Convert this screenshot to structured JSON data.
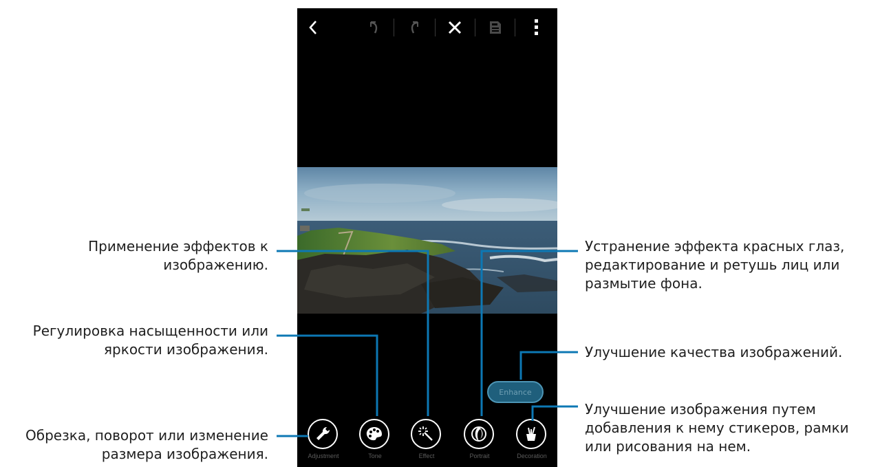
{
  "phone": {
    "enhance_button": "Enhance",
    "toolbar": [
      "Adjustment",
      "Tone",
      "Effect",
      "Portrait",
      "Decoration"
    ]
  },
  "callouts": {
    "effect": "Применение эффектов к изображению.",
    "tone": "Регулировка насыщенности или яркости изображения.",
    "adjustment": "Обрезка, поворот или изменение размера изображения.",
    "portrait": "Устранение эффекта красных глаз, редактирование и ретушь лиц или размытие фона.",
    "enhance": "Улучшение качества изображений.",
    "decoration": "Улучшение изображения путем добавления к нему стикеров, рамки или рисования на нем."
  },
  "colors": {
    "leader_line": "#0d78b4",
    "accent": "#1f5f7c"
  },
  "icons": [
    "back-icon",
    "undo-icon",
    "redo-icon",
    "close-icon",
    "save-icon",
    "more-icon",
    "wrench-icon",
    "palette-icon",
    "magic-wand-icon",
    "portrait-icon",
    "brush-cup-icon"
  ]
}
